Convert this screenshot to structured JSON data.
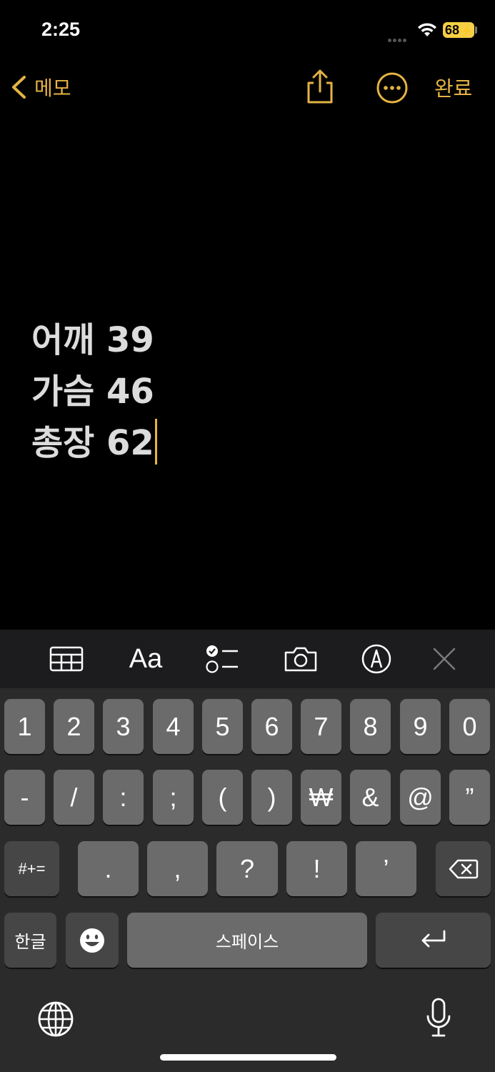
{
  "status": {
    "time": "2:25",
    "battery": "68"
  },
  "nav": {
    "back_label": "메모",
    "done_label": "완료"
  },
  "note": {
    "lines": [
      "어깨 39",
      "가슴 46",
      "총장 62"
    ]
  },
  "toolbar": {
    "format_label": "Aa"
  },
  "keyboard": {
    "row1": [
      "1",
      "2",
      "3",
      "4",
      "5",
      "6",
      "7",
      "8",
      "9",
      "0"
    ],
    "row2": [
      "-",
      "/",
      ":",
      ";",
      "(",
      ")",
      "₩",
      "&",
      "@",
      "”"
    ],
    "row3": {
      "more_symbols": "#+=",
      "keys": [
        ".",
        ",",
        "?",
        "!",
        "’"
      ]
    },
    "row4": {
      "lang": "한글",
      "space": "스페이스"
    }
  },
  "colors": {
    "accent": "#e5b344",
    "key": "#6b6b6b",
    "key_dark": "#464646",
    "keyboard_bg": "#2b2b2b"
  }
}
